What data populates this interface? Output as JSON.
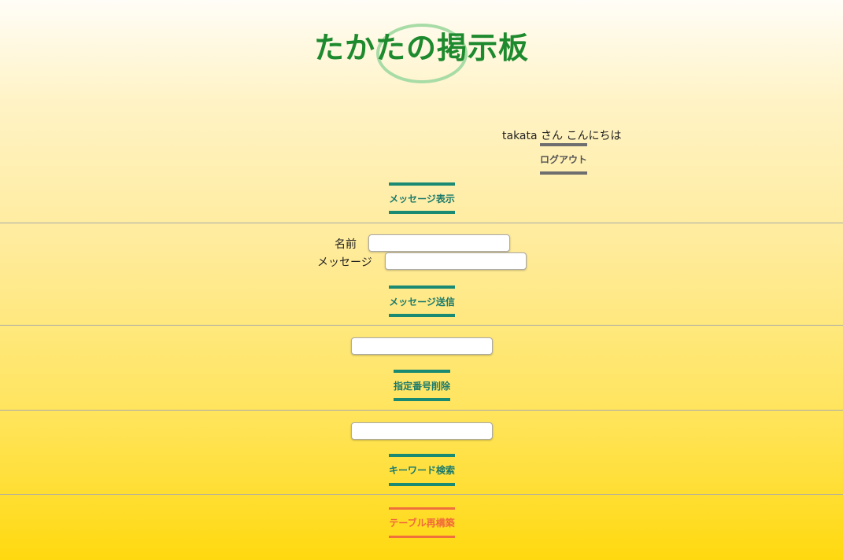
{
  "header": {
    "title": "たかたの掲示板"
  },
  "user": {
    "greeting": "takata さん こんにちは",
    "logout_label": "ログアウト"
  },
  "actions": {
    "show_messages_label": "メッセージ表示"
  },
  "post_form": {
    "name_label": "名前",
    "name_value": "",
    "message_label": "メッセージ",
    "message_value": "",
    "submit_label": "メッセージ送信"
  },
  "delete_form": {
    "number_value": "",
    "submit_label": "指定番号削除"
  },
  "search_form": {
    "keyword_value": "",
    "submit_label": "キーワード検索"
  },
  "admin": {
    "rebuild_label": "テーブル再構築"
  },
  "colors": {
    "title_green": "#1e8a2e",
    "ellipse_green": "#a8dca6",
    "teal_button": "#1b8a73",
    "gray_button": "#6e6e6e",
    "orange_button": "#f0703c"
  }
}
